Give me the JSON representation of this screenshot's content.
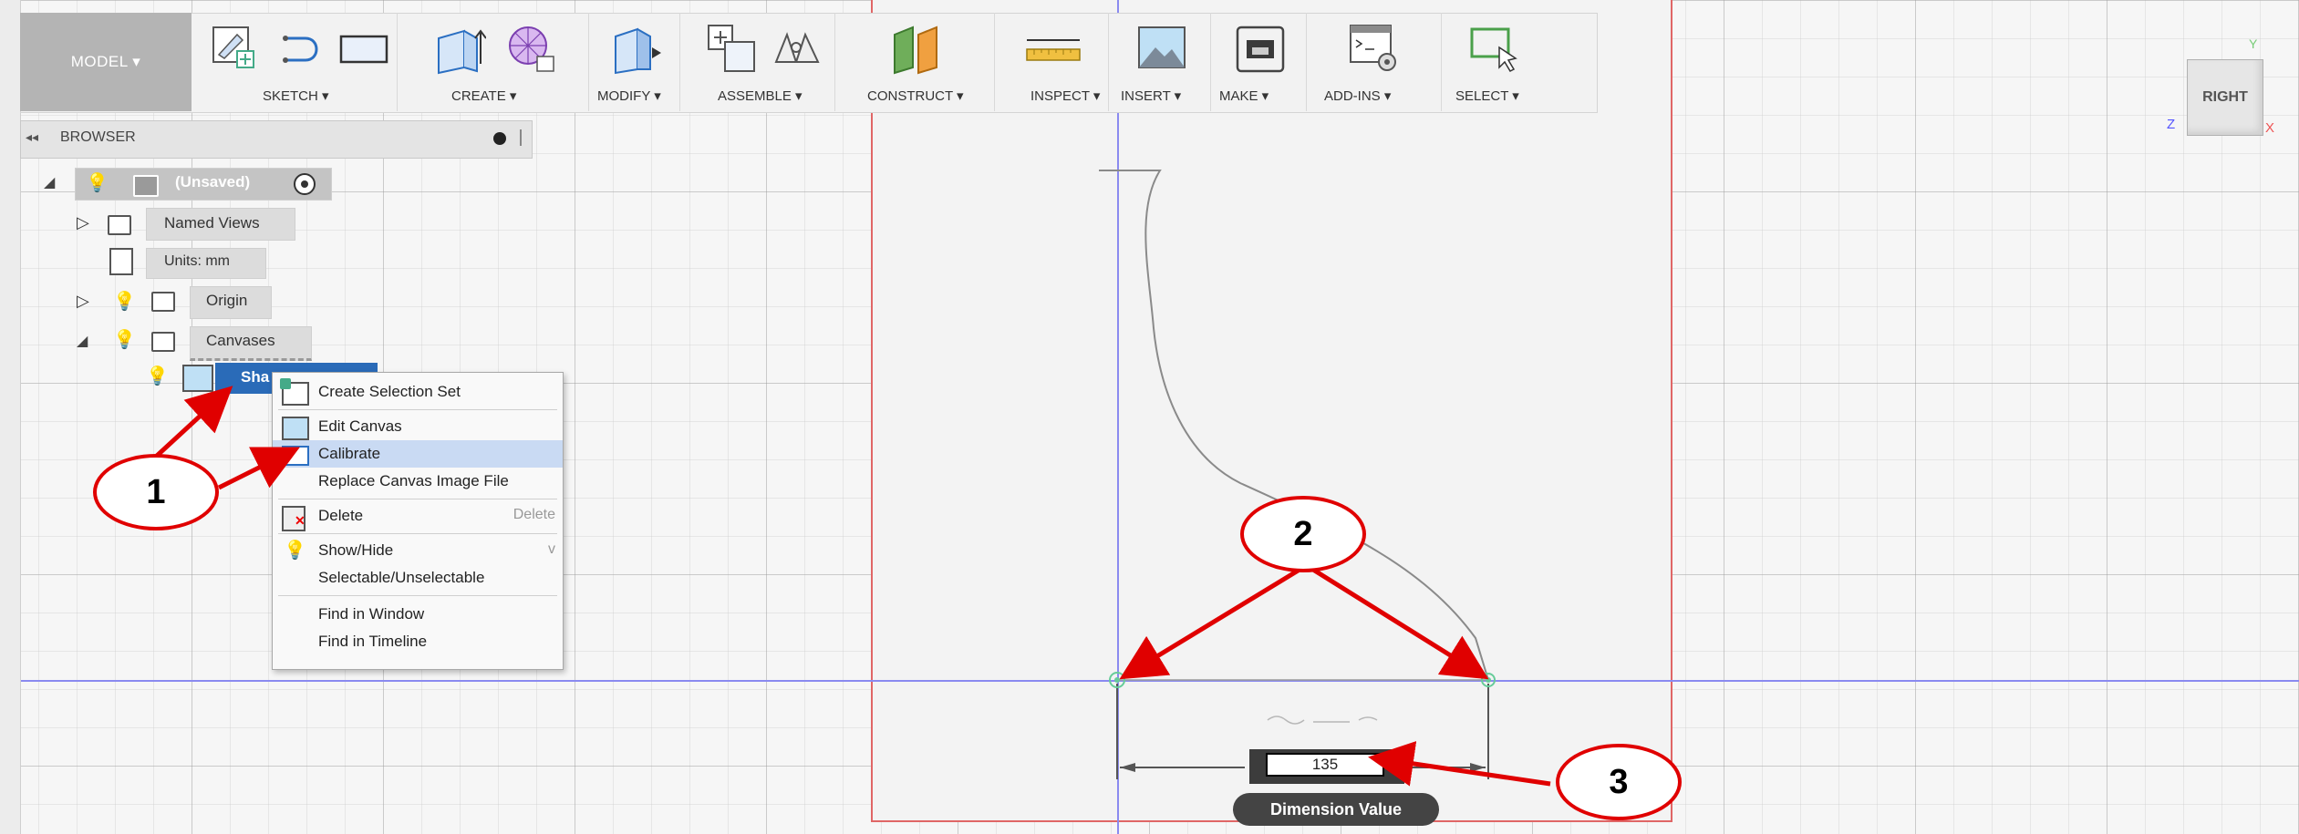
{
  "toolbar": {
    "model_label": "MODEL ▾",
    "groups": [
      {
        "label": "SKETCH ▾"
      },
      {
        "label": "CREATE ▾"
      },
      {
        "label": "MODIFY ▾"
      },
      {
        "label": "ASSEMBLE ▾"
      },
      {
        "label": "CONSTRUCT ▾"
      },
      {
        "label": "INSPECT ▾"
      },
      {
        "label": "INSERT ▾"
      },
      {
        "label": "MAKE ▾"
      },
      {
        "label": "ADD-INS ▾"
      },
      {
        "label": "SELECT ▾"
      }
    ]
  },
  "browser": {
    "title": "BROWSER",
    "collapse": "◂◂",
    "root_label": "(Unsaved)",
    "items": [
      {
        "label": "Named Views"
      },
      {
        "label": "Units: mm"
      },
      {
        "label": "Origin"
      },
      {
        "label": "Canvases"
      }
    ],
    "canvas_item": "Sha"
  },
  "context_menu": {
    "items": [
      {
        "label": "Create Selection Set",
        "shortcut": ""
      },
      {
        "label": "Edit Canvas",
        "shortcut": ""
      },
      {
        "label": "Calibrate",
        "shortcut": ""
      },
      {
        "label": "Replace Canvas Image File",
        "shortcut": ""
      },
      {
        "label": "Delete",
        "shortcut": "Delete"
      },
      {
        "label": "Show/Hide",
        "shortcut": "v"
      },
      {
        "label": "Selectable/Unselectable",
        "shortcut": ""
      },
      {
        "label": "Find in Window",
        "shortcut": ""
      },
      {
        "label": "Find in Timeline",
        "shortcut": ""
      }
    ],
    "highlighted": "Calibrate"
  },
  "dimension": {
    "value": "135",
    "tooltip": "Dimension Value"
  },
  "callouts": [
    "1",
    "2",
    "3"
  ],
  "view_cube": {
    "face": "RIGHT",
    "y": "Y",
    "z": "Z",
    "x": "X"
  },
  "colors": {
    "accent_red": "#e00000",
    "highlight_blue": "#c9daf3",
    "axis_blue": "#8a8af0"
  }
}
